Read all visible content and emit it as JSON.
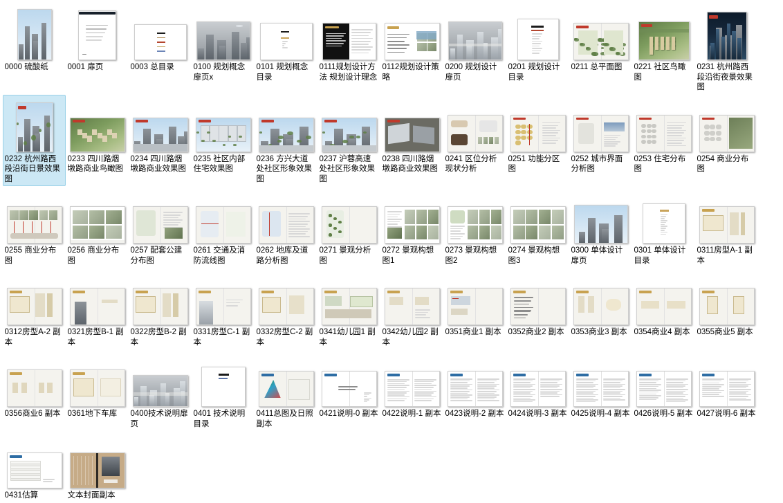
{
  "view": {
    "mode": "large-icons-thumbnail-grid",
    "selected_index": 12,
    "selection_color": "#cce8f5",
    "selection_border_color": "#99d1e8",
    "background_color": "#ffffff",
    "columns": 12,
    "total_items": 62
  },
  "items": [
    {
      "label": "0000 硫酸纸",
      "art": "tower-photo"
    },
    {
      "label": "0001 扉页",
      "art": "doc-white-title"
    },
    {
      "label": "0003 总目录",
      "art": "toc-color-bars"
    },
    {
      "label": "0100 规划概念扉页x",
      "art": "tower-photo-wide"
    },
    {
      "label": "0101 规划概念目录",
      "art": "toc-short"
    },
    {
      "label": "0111规划设计方法 规划设计理念",
      "art": "black-left-spread"
    },
    {
      "label": "0112规划设计策略",
      "art": "spread-text-images"
    },
    {
      "label": "0200 规划设计扉页",
      "art": "grey-aerial"
    },
    {
      "label": "0201 规划设计目录",
      "art": "toc-lines"
    },
    {
      "label": "0211 总平面图",
      "art": "siteplan-green"
    },
    {
      "label": "0221 社区鸟瞰图",
      "art": "aerial-render"
    },
    {
      "label": "0231 杭州路西段沿街夜景效果图",
      "art": "night-render"
    },
    {
      "label": "0232 杭州路西段沿街日景效果图",
      "art": "day-render"
    },
    {
      "label": "0233 四川路烟墩路商业鸟瞰图",
      "art": "aerial-commercial"
    },
    {
      "label": "0234 四川路烟墩路商业效果图",
      "art": "street-render"
    },
    {
      "label": "0235 社区内部住宅效果图",
      "art": "interior-court-render"
    },
    {
      "label": "0236 方兴大道处社区形象效果图",
      "art": "street-render-2"
    },
    {
      "label": "0237 沪蓉高速处社区形象效果图",
      "art": "street-render-3"
    },
    {
      "label": "0238 四川路烟墩路商业效果图",
      "art": "commercial-render"
    },
    {
      "label": "0241 区位分析现状分析",
      "art": "analysis-spread"
    },
    {
      "label": "0251 功能分区图",
      "art": "zoning-plan"
    },
    {
      "label": "0252 城市界面分析图",
      "art": "urban-interface"
    },
    {
      "label": "0253 住宅分布图",
      "art": "residential-dist"
    },
    {
      "label": "0254 商业分布图",
      "art": "commercial-dist"
    },
    {
      "label": "0255 商业分布图",
      "art": "commercial-dist-2"
    },
    {
      "label": "0256 商业分布图",
      "art": "photo-grid"
    },
    {
      "label": "0257 配套公建分布图",
      "art": "public-facility"
    },
    {
      "label": "0261 交通及消防流线图",
      "art": "traffic-plan"
    },
    {
      "label": "0262 地库及道路分析图",
      "art": "garage-plan"
    },
    {
      "label": "0271 景观分析图",
      "art": "landscape-analysis"
    },
    {
      "label": "0272 景观构想图1",
      "art": "landscape-concept-1"
    },
    {
      "label": "0273 景观构想图2",
      "art": "landscape-concept-2"
    },
    {
      "label": "0274 景观构想图3",
      "art": "landscape-concept-3"
    },
    {
      "label": "0300 单体设计扉页",
      "art": "tower-photo-sky"
    },
    {
      "label": "0301 单体设计目录",
      "art": "toc-gold"
    },
    {
      "label": "0311房型A-1 副本",
      "art": "unit-plan-a"
    },
    {
      "label": "0312房型A-2 副本",
      "art": "unit-plan-a2"
    },
    {
      "label": "0321房型B-1 副本",
      "art": "unit-plan-b"
    },
    {
      "label": "0322房型B-2 副本",
      "art": "unit-plan-b2"
    },
    {
      "label": "0331房型C-1 副本",
      "art": "unit-plan-c"
    },
    {
      "label": "0332房型C-2 副本",
      "art": "unit-plan-c2"
    },
    {
      "label": "0341幼儿园1 副本",
      "art": "kindergarten-1"
    },
    {
      "label": "0342幼儿园2 副本",
      "art": "kindergarten-2"
    },
    {
      "label": "0351商业1 副本",
      "art": "shop-1"
    },
    {
      "label": "0352商业2 副本",
      "art": "shop-2"
    },
    {
      "label": "0353商业3 副本",
      "art": "shop-3"
    },
    {
      "label": "0354商业4 副本",
      "art": "shop-4"
    },
    {
      "label": "0355商业5 副本",
      "art": "shop-5"
    },
    {
      "label": "0356商业6 副本",
      "art": "shop-6"
    },
    {
      "label": "0361地下车库",
      "art": "garage-gold"
    },
    {
      "label": "0400技术说明扉页",
      "art": "grey-aerial-2"
    },
    {
      "label": "0401 技术说明目录",
      "art": "toc-blue"
    },
    {
      "label": "0411总图及日照 副本",
      "art": "sunlight-analysis"
    },
    {
      "label": "0421说明-0 副本",
      "art": "spec-title"
    },
    {
      "label": "0422说明-1 副本",
      "art": "spec-text"
    },
    {
      "label": "0423说明-2 副本",
      "art": "spec-text-2"
    },
    {
      "label": "0424说明-3 副本",
      "art": "spec-text-3"
    },
    {
      "label": "0425说明-4 副本",
      "art": "spec-text-4"
    },
    {
      "label": "0426说明-5 副本",
      "art": "spec-text-5"
    },
    {
      "label": "0427说明-6 副本",
      "art": "spec-text-6"
    },
    {
      "label": "0431估算",
      "art": "estimate-table"
    },
    {
      "label": "文本封面副本",
      "art": "kraft-cover"
    }
  ]
}
